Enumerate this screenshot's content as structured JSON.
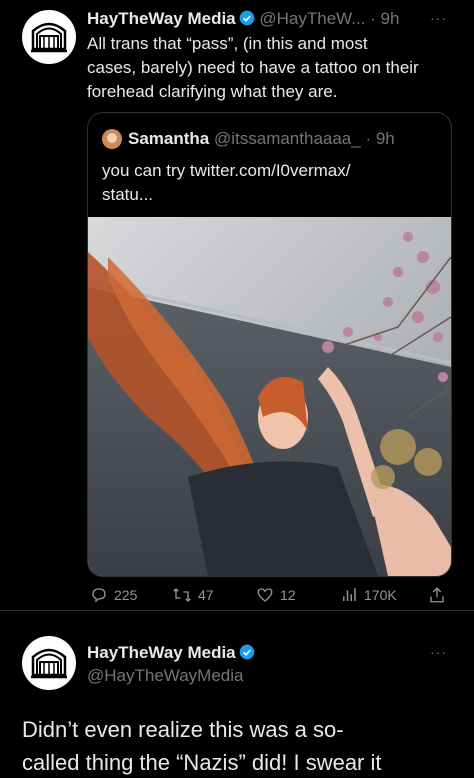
{
  "tweet1": {
    "display_name": "HayTheWay Media",
    "handle": "@HayTheW...",
    "time": "· 9h",
    "more": "···",
    "text_lines": [
      "All trans that “pass”, (in this and most",
      "cases, barely) need to have a tattoo on their",
      "forehead clarifying what they are."
    ],
    "quote": {
      "display_name": "Samantha",
      "handle": "@itssamanthaaaa_",
      "time": "· 9h",
      "text_lines": [
        "you can try twitter.com/I0vermax/",
        "statu..."
      ]
    },
    "actions": {
      "replies": "225",
      "retweets": "47",
      "likes": "12",
      "views": "170K"
    }
  },
  "tweet2": {
    "display_name": "HayTheWay Media",
    "handle": "@HayTheWayMedia",
    "more": "···",
    "text_lines": [
      "Didn’t even realize this was a so-",
      "called thing the “Nazis” did! I swear it"
    ]
  },
  "colors": {
    "accent": "#1d9bf0",
    "background": "#000000",
    "muted": "#71767b"
  }
}
